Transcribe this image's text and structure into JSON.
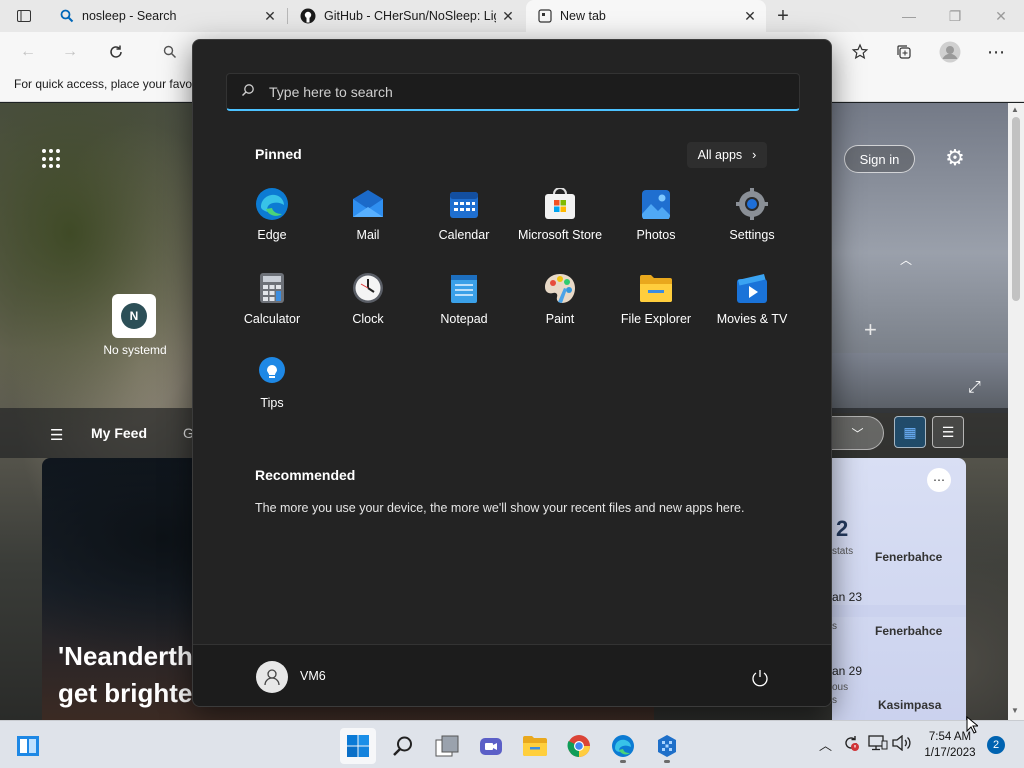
{
  "browser": {
    "tabs": [
      {
        "title": "nosleep - Search",
        "icon": "search-icon"
      },
      {
        "title": "GitHub - CHerSun/NoSleep: Lig",
        "icon": "github-icon"
      },
      {
        "title": "New tab",
        "icon": "new-tab-page-icon",
        "active": true
      }
    ],
    "favorites_hint": "For quick access, place your favo"
  },
  "ntp": {
    "quick_link_initial": "N",
    "quick_link_label": "No systemd",
    "signin_label": "Sign in",
    "feed_tab": "My Feed",
    "feed_next": "G",
    "headline": "'Neanderth\nget brighte",
    "sports": {
      "score": "2",
      "stats": "stats",
      "team1": "Fenerbahce",
      "date2": "an 23",
      "sub2a": "ous",
      "sub2b": "s",
      "team2": "Fenerbahce",
      "date3": "an 29",
      "sub3a": "ous",
      "sub3b": "s",
      "team3": "Kasimpasa"
    }
  },
  "start_menu": {
    "search_placeholder": "Type here to search",
    "pinned_heading": "Pinned",
    "all_apps_label": "All apps",
    "pinned": [
      {
        "label": "Edge",
        "icon": "edge-icon"
      },
      {
        "label": "Mail",
        "icon": "mail-icon"
      },
      {
        "label": "Calendar",
        "icon": "calendar-icon"
      },
      {
        "label": "Microsoft Store",
        "icon": "store-icon"
      },
      {
        "label": "Photos",
        "icon": "photos-icon"
      },
      {
        "label": "Settings",
        "icon": "settings-icon"
      },
      {
        "label": "Calculator",
        "icon": "calculator-icon"
      },
      {
        "label": "Clock",
        "icon": "clock-icon"
      },
      {
        "label": "Notepad",
        "icon": "notepad-icon"
      },
      {
        "label": "Paint",
        "icon": "paint-icon"
      },
      {
        "label": "File Explorer",
        "icon": "file-explorer-icon"
      },
      {
        "label": "Movies & TV",
        "icon": "movies-icon"
      },
      {
        "label": "Tips",
        "icon": "tips-icon"
      }
    ],
    "recommended_heading": "Recommended",
    "recommended_text": "The more you use your device, the more we'll show your recent files and new apps here.",
    "user_name": "VM6"
  },
  "taskbar": {
    "time": "7:54 AM",
    "date": "1/17/2023",
    "notification_count": "2"
  },
  "colors": {
    "accent": "#4cc2ff",
    "start_bg": "#232323",
    "taskbar_bg": "#dfe3ea"
  }
}
